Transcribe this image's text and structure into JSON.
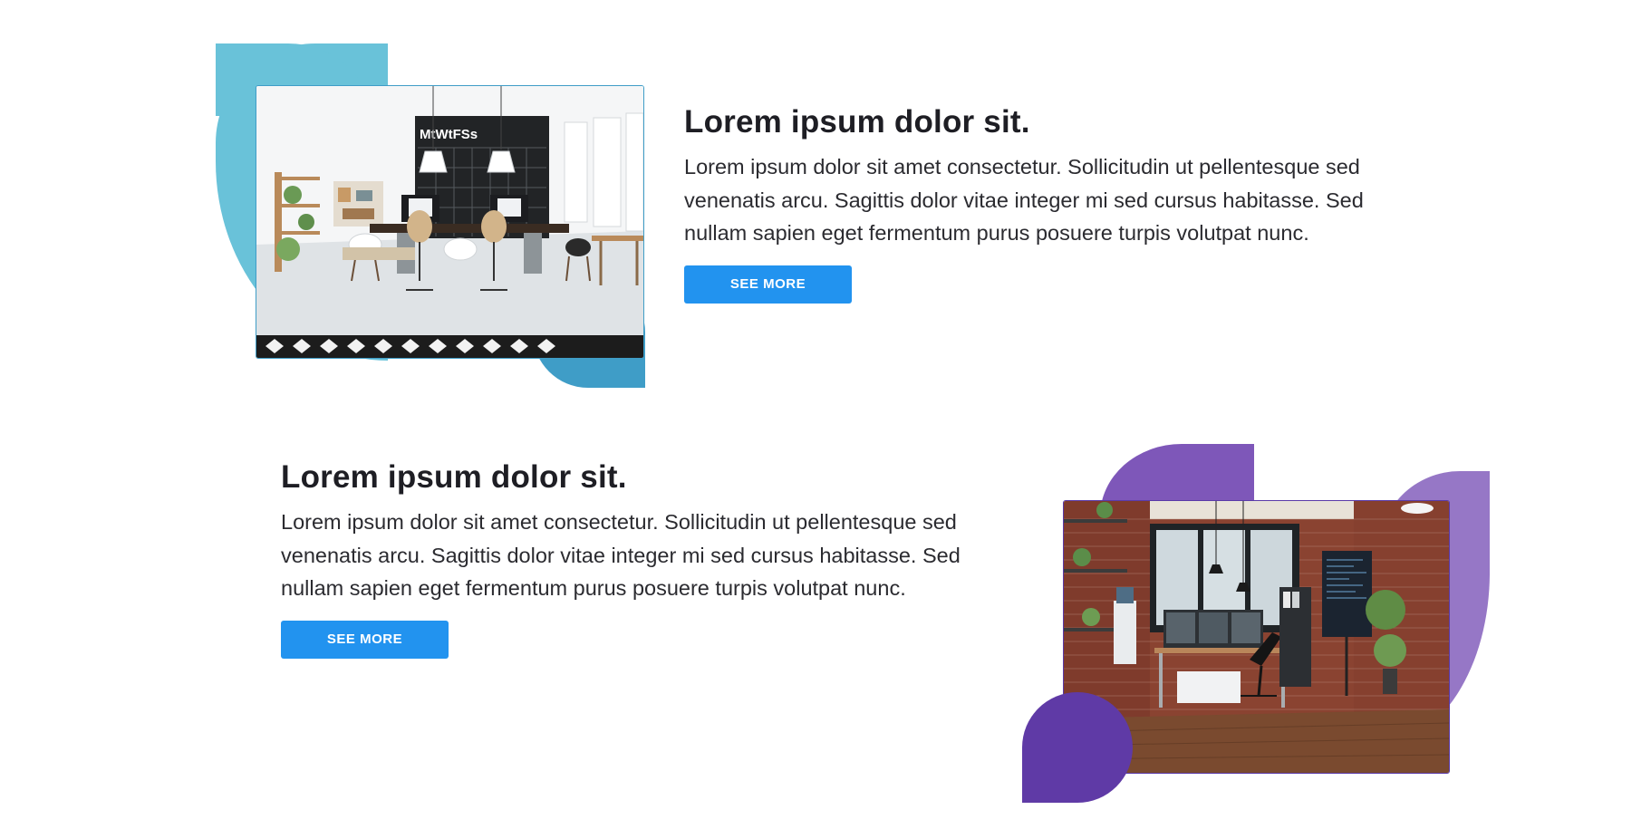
{
  "features": [
    {
      "heading": "Lorem ipsum dolor sit.",
      "body": "Lorem ipsum dolor sit amet consectetur. Sollicitudin ut pellentesque sed venenatis arcu. Sagittis dolor vitae integer mi sed cursus habitasse. Sed nullam sapien eget fermentum purus posuere turpis volutpat nunc.",
      "button_label": "SEE MORE",
      "image": "office-workspace-photo",
      "calendar_letters": "MtWtFSs"
    },
    {
      "heading": "Lorem ipsum dolor sit.",
      "body": "Lorem ipsum dolor sit amet consectetur. Sollicitudin ut pellentesque sed venenatis arcu. Sagittis dolor vitae integer mi sed cursus habitasse. Sed nullam sapien eget fermentum purus posuere turpis volutpat nunc.",
      "button_label": "SEE MORE",
      "image": "brick-office-photo"
    }
  ],
  "colors": {
    "button": "#2293ef",
    "cyan_blob": "#69c2d9",
    "blue_blob": "#3f9dc7",
    "purple_blob": "#7e57b9",
    "light_purple_blob": "#9677c6",
    "dark_purple_blob": "#5f3aa6"
  }
}
